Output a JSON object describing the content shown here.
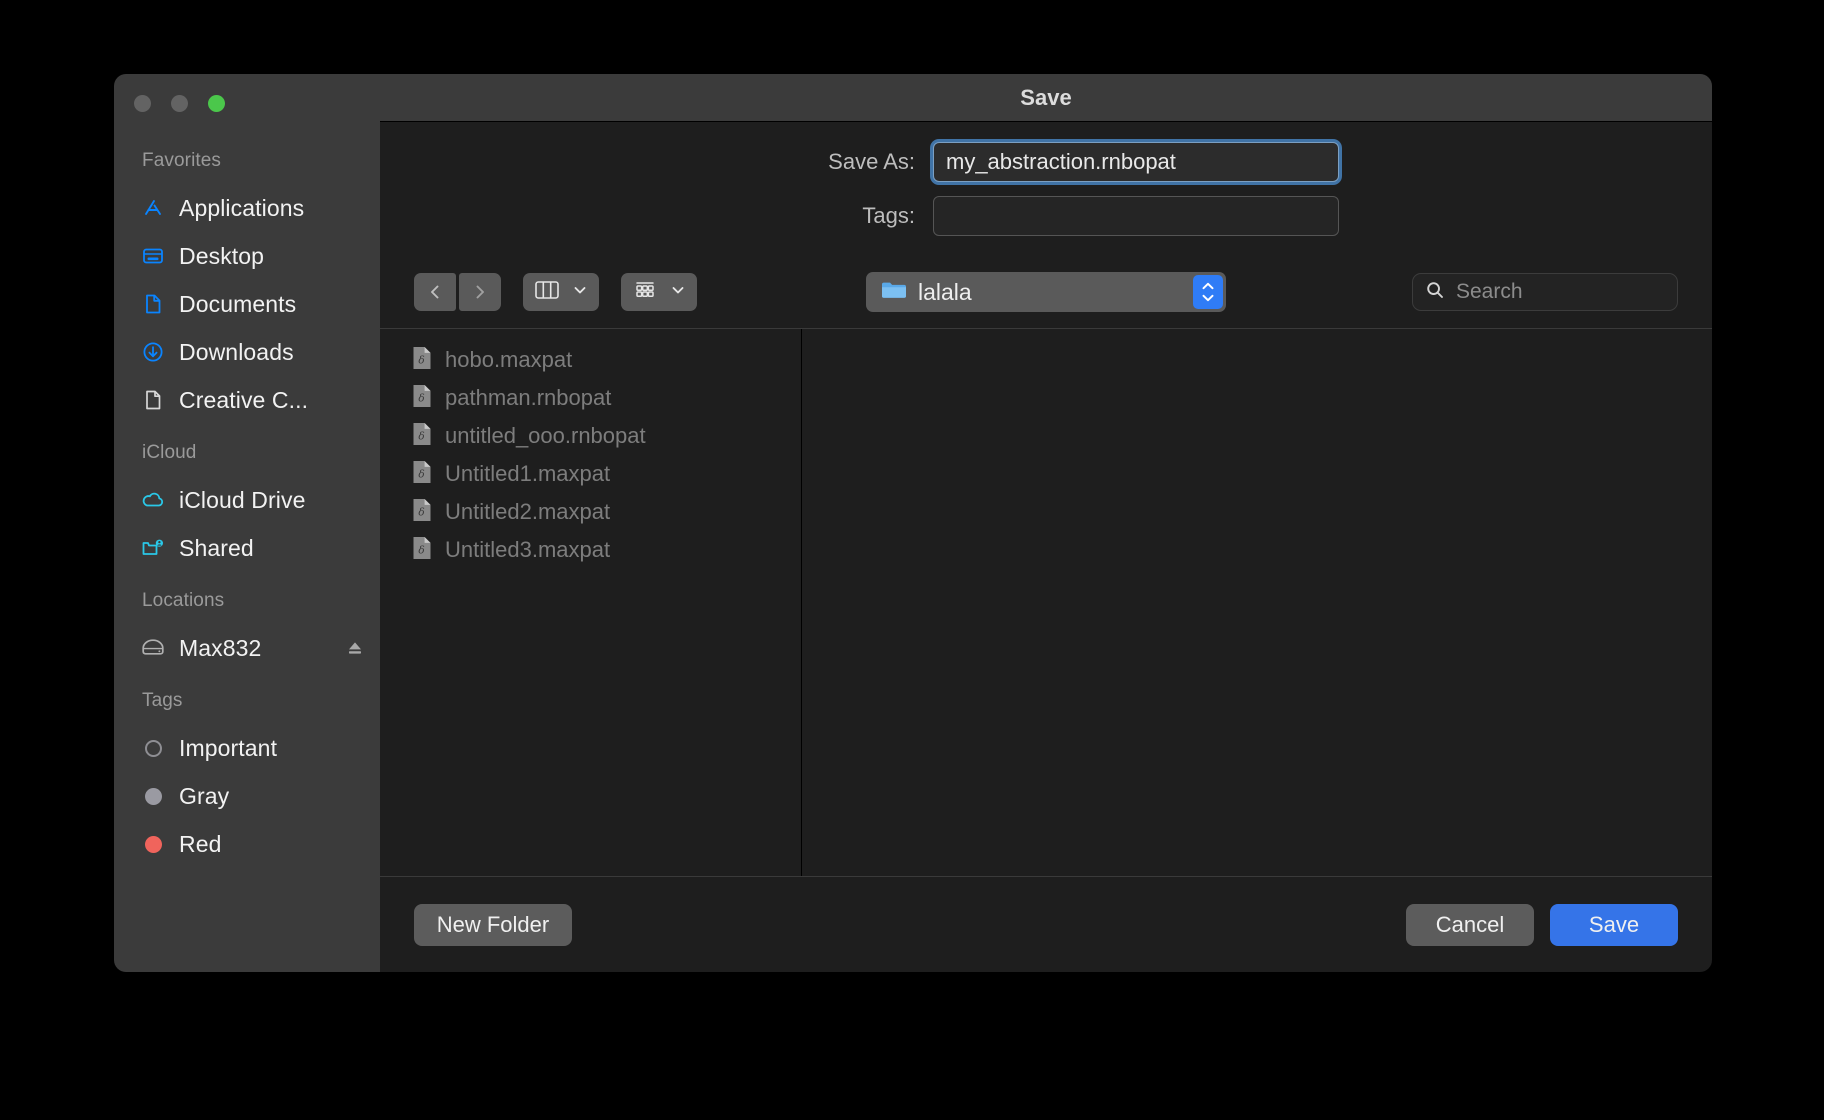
{
  "window": {
    "title": "Save",
    "traffic_lights": [
      {
        "name": "close",
        "color": "#636363"
      },
      {
        "name": "minimize",
        "color": "#636363"
      },
      {
        "name": "zoom",
        "color": "#4bc74b"
      }
    ]
  },
  "sidebar": {
    "sections": [
      {
        "title": "Favorites",
        "items": [
          {
            "label": "Applications",
            "icon": "applications-icon",
            "color": "#0a84ff"
          },
          {
            "label": "Desktop",
            "icon": "desktop-icon",
            "color": "#0a84ff"
          },
          {
            "label": "Documents",
            "icon": "documents-icon",
            "color": "#0a84ff"
          },
          {
            "label": "Downloads",
            "icon": "downloads-icon",
            "color": "#0a84ff"
          },
          {
            "label": "Creative C...",
            "icon": "document-icon",
            "color": "#d8d8d8"
          }
        ]
      },
      {
        "title": "iCloud",
        "items": [
          {
            "label": "iCloud Drive",
            "icon": "cloud-icon",
            "color": "#2ac8e8"
          },
          {
            "label": "Shared",
            "icon": "shared-folder-icon",
            "color": "#2ac8e8"
          }
        ]
      },
      {
        "title": "Locations",
        "items": [
          {
            "label": "Max832",
            "icon": "drive-icon",
            "color": "#b0b0b0",
            "eject": true
          }
        ]
      },
      {
        "title": "Tags",
        "items": [
          {
            "label": "Important",
            "icon": "tag-dot-hollow",
            "color": "#8e8e93"
          },
          {
            "label": "Gray",
            "icon": "tag-dot",
            "color": "#9a9aa2"
          },
          {
            "label": "Red",
            "icon": "tag-dot",
            "color": "#f0645c"
          }
        ]
      }
    ]
  },
  "fields": {
    "save_as": {
      "label": "Save As:",
      "value": "my_abstraction.rnbopat",
      "placeholder": ""
    },
    "tags": {
      "label": "Tags:",
      "value": "",
      "placeholder": ""
    }
  },
  "toolbar": {
    "back_icon": "chevron-left-icon",
    "forward_icon": "chevron-right-icon",
    "view_mode_icon": "column-view-icon",
    "group_by_icon": "group-by-icon",
    "path_label": "lalala",
    "path_icon": "folder-icon",
    "stepper_icon": "stepper-updown-icon",
    "up_icon": "chevron-up-icon",
    "search": {
      "icon": "search-icon",
      "placeholder": "Search",
      "value": ""
    },
    "accent_color": "#2f7cf6"
  },
  "browser": {
    "files": [
      {
        "name": "hobo.maxpat",
        "icon": "patch-file-icon"
      },
      {
        "name": "pathman.rnbopat",
        "icon": "patch-file-icon"
      },
      {
        "name": "untitled_ooo.rnbopat",
        "icon": "patch-file-icon"
      },
      {
        "name": "Untitled1.maxpat",
        "icon": "patch-file-icon"
      },
      {
        "name": "Untitled2.maxpat",
        "icon": "patch-file-icon"
      },
      {
        "name": "Untitled3.maxpat",
        "icon": "patch-file-icon"
      }
    ]
  },
  "bottom_bar": {
    "new_folder_label": "New Folder",
    "cancel_label": "Cancel",
    "save_label": "Save",
    "save_color": "#3574e8"
  }
}
